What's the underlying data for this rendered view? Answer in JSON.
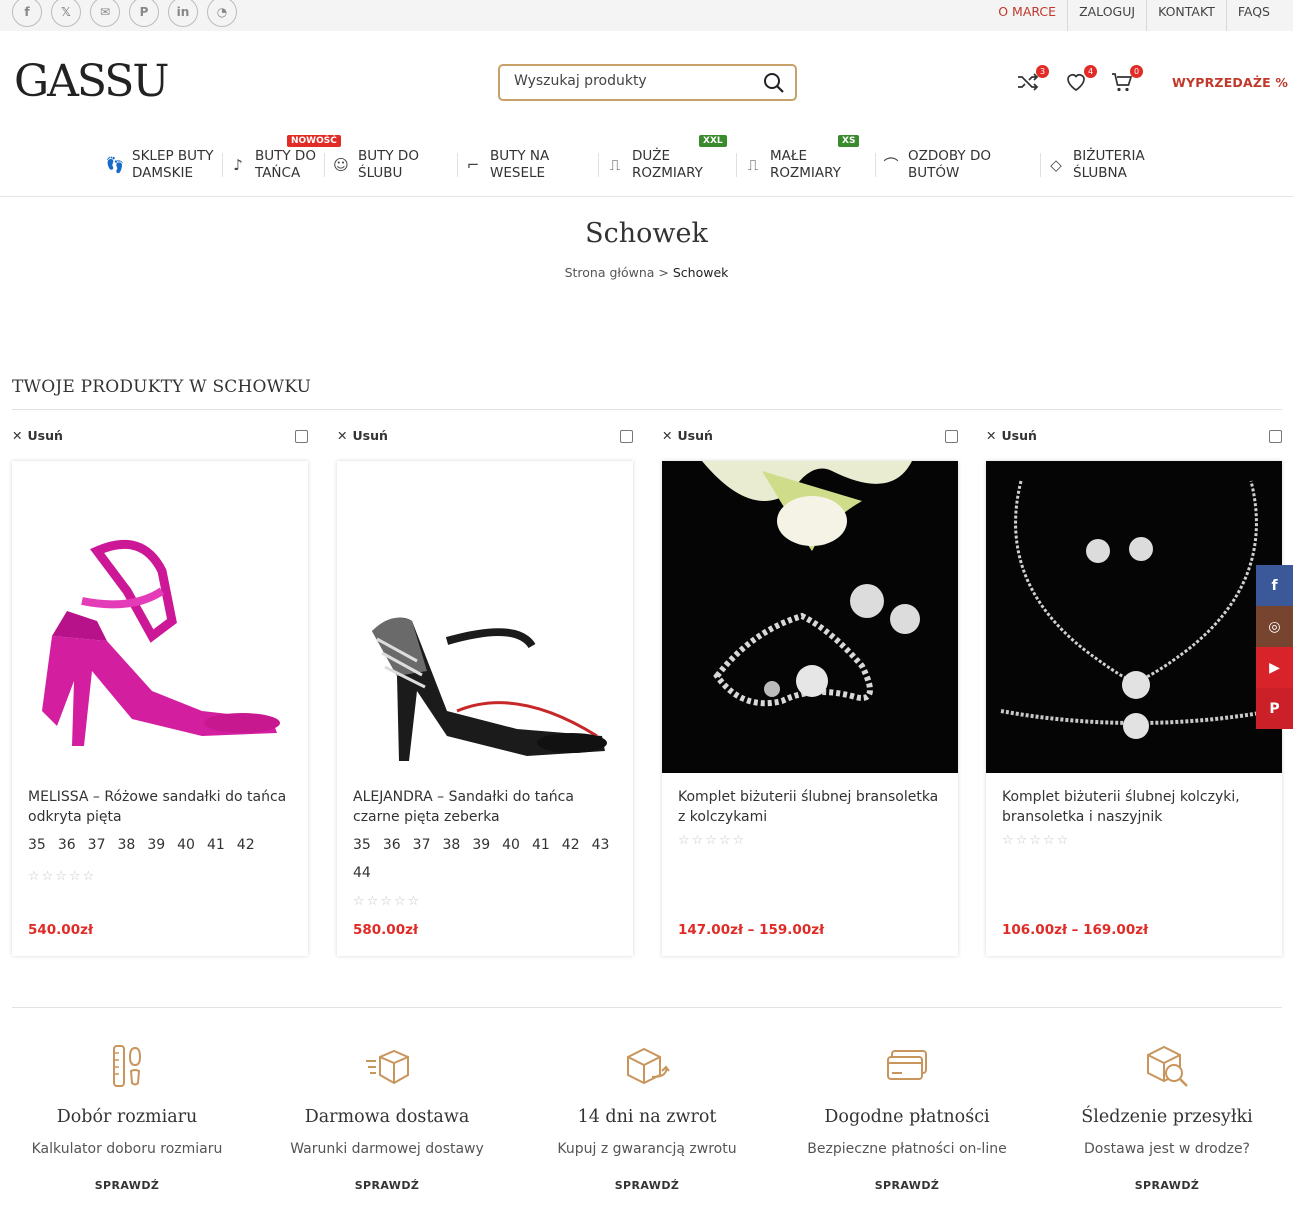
{
  "topbar": {
    "social": [
      {
        "icon": "facebook-icon",
        "glyph": "f"
      },
      {
        "icon": "x-icon",
        "glyph": "𝕏"
      },
      {
        "icon": "mail-icon",
        "glyph": "✉"
      },
      {
        "icon": "pinterest-icon",
        "glyph": "P"
      },
      {
        "icon": "linkedin-icon",
        "glyph": "in"
      },
      {
        "icon": "whatsapp-icon",
        "glyph": "◔"
      }
    ],
    "links": [
      "O MARCE",
      "ZALOGUJ",
      "KONTAKT",
      "FAQS"
    ]
  },
  "header": {
    "logo": "GASSU",
    "search_placeholder": "Wyszukaj produkty",
    "compare_count": "3",
    "wishlist_count": "4",
    "cart_count": "0",
    "sale_label": "WYPRZEDAŻE %"
  },
  "nav": {
    "items": [
      {
        "line1": "SKLEP BUTY",
        "line2": "DAMSKIE",
        "icon": "footprints-icon"
      },
      {
        "line1": "BUTY DO",
        "line2": "TAŃCA",
        "icon": "dancer-icon",
        "tag": "NOWOŚĆ"
      },
      {
        "line1": "BUTY DO",
        "line2": "ŚLUBU",
        "icon": "bride-icon"
      },
      {
        "line1": "BUTY NA",
        "line2": "WESELE",
        "icon": "heel-shoe-icon"
      },
      {
        "line1": "DUŻE",
        "line2": "ROZMIARY",
        "icon": "foot-icon",
        "tag": "XXL"
      },
      {
        "line1": "MAŁE",
        "line2": "ROZMIARY",
        "icon": "foot-small-icon",
        "tag": "XS"
      },
      {
        "line1": "OZDOBY DO",
        "line2": "BUTÓW",
        "icon": "shoe-clip-icon"
      },
      {
        "line1": "BIŻUTERIA",
        "line2": "ŚLUBNA",
        "icon": "diamond-icon"
      }
    ],
    "tag_colors": {
      "NOWOŚĆ": "#e02b27",
      "XXL": "#3a8a2e",
      "XS": "#3a8a2e"
    }
  },
  "page": {
    "title": "Schowek",
    "breadcrumb_home": "Strona główna",
    "breadcrumb_sep": ">",
    "breadcrumb_current": "Schowek",
    "section_title": "TWOJE PRODUKTY W SCHOWKU"
  },
  "products": [
    {
      "remove_label": "Usuń",
      "name": "MELISSA – Różowe sandałki do tańca odkryta pięta",
      "sizes": [
        "35",
        "36",
        "37",
        "38",
        "39",
        "40",
        "41",
        "42"
      ],
      "rating": "☆☆☆☆☆",
      "price": "540.00zł"
    },
    {
      "remove_label": "Usuń",
      "name": "ALEJANDRA – Sandałki do tańca czarne pięta zeberka",
      "sizes": [
        "35",
        "36",
        "37",
        "38",
        "39",
        "40",
        "41",
        "42",
        "43",
        "44"
      ],
      "rating": "☆☆☆☆☆",
      "price": "580.00zł"
    },
    {
      "remove_label": "Usuń",
      "name": "Komplet biżuterii ślubnej bransoletka z kolczykami",
      "sizes": [],
      "rating": "☆☆☆☆☆",
      "price": "147.00zł – 159.00zł"
    },
    {
      "remove_label": "Usuń",
      "name": "Komplet biżuterii ślubnej kolczyki, bransoletka i naszyjnik",
      "sizes": [],
      "rating": "☆☆☆☆☆",
      "price": "106.00zł – 169.00zł"
    }
  ],
  "features": [
    {
      "title": "Dobór rozmiaru",
      "desc": "Kalkulator doboru rozmiaru",
      "button": "SPRAWDŹ",
      "icon": "ruler-footprint-icon"
    },
    {
      "title": "Darmowa dostawa",
      "desc": "Warunki darmowej dostawy",
      "button": "SPRAWDŹ",
      "icon": "delivery-box-icon"
    },
    {
      "title": "14 dni na zwrot",
      "desc": "Kupuj z gwarancją zwrotu",
      "button": "SPRAWDŹ",
      "icon": "return-box-icon"
    },
    {
      "title": "Dogodne płatności",
      "desc": "Bezpieczne płatności on-line",
      "button": "SPRAWDŹ",
      "icon": "credit-card-icon"
    },
    {
      "title": "Śledzenie przesyłki",
      "desc": "Dostawa jest w drodze?",
      "button": "SPRAWDŹ",
      "icon": "package-search-icon"
    }
  ],
  "side_social": [
    {
      "icon": "facebook-icon",
      "glyph": "f",
      "color": "#3b5998"
    },
    {
      "icon": "instagram-icon",
      "glyph": "◎",
      "color": "#774430"
    },
    {
      "icon": "youtube-icon",
      "glyph": "▶",
      "color": "#d8232a"
    },
    {
      "icon": "pinterest-icon",
      "glyph": "P",
      "color": "#cb2027"
    }
  ],
  "colors": {
    "accent": "#c8a06a",
    "price": "#e02b27",
    "sale": "#c0392b"
  }
}
